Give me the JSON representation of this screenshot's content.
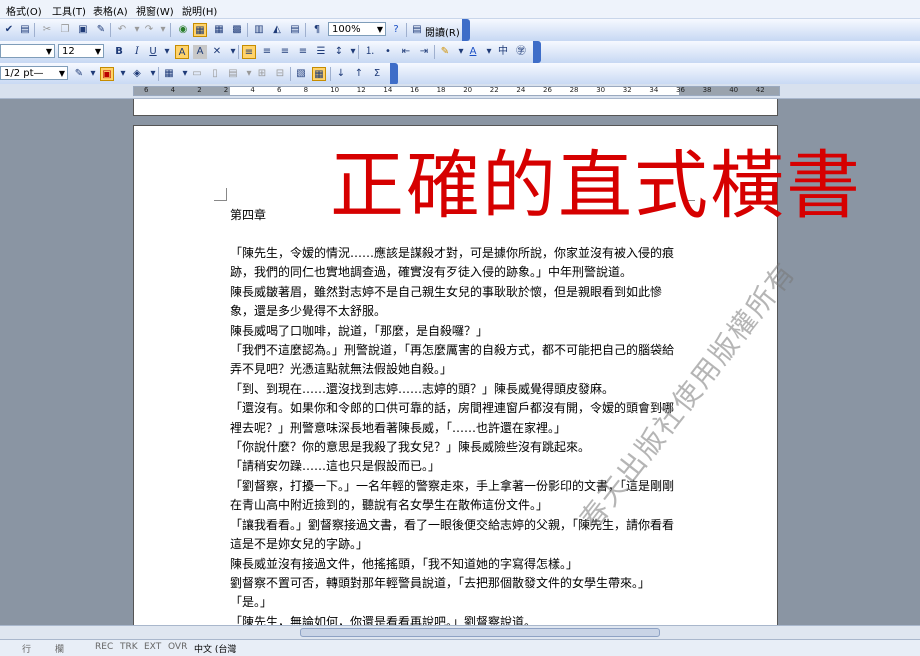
{
  "menu": [
    {
      "label": "格式(O)"
    },
    {
      "label": "工具(T)"
    },
    {
      "label": "表格(A)"
    },
    {
      "label": "視窗(W)"
    },
    {
      "label": "說明(H)"
    }
  ],
  "toolbar1": {
    "zoom": "100%",
    "read_label": "閱讀(R)"
  },
  "toolbar2": {
    "font_size": "12"
  },
  "toolbar3": {
    "border_width": "1/2 pt—"
  },
  "ruler": {
    "numbers": [
      "6",
      "4",
      "2",
      "2",
      "4",
      "6",
      "8",
      "10",
      "12",
      "14",
      "16",
      "18",
      "20",
      "22",
      "24",
      "26",
      "28",
      "30",
      "32",
      "34",
      "36",
      "38",
      "40",
      "42"
    ]
  },
  "overlay": {
    "title": "正確的直式橫書",
    "watermark": "春天出版社使用版權所有"
  },
  "document": {
    "chapter": "第四章",
    "paragraphs": [
      "「陳先生，令嫒的情況……應該是謀殺才對，可是據你所說，你家並沒有被入侵的痕跡，我們的同仁也實地調查過，確實沒有歹徒入侵的跡象。」中年刑警說道。",
      "陳長威皺著眉，雖然對志婷不是自己親生女兒的事耿耿於懷，但是親眼看到如此慘象，還是多少覺得不太舒服。",
      "陳長威喝了口咖啡，說道，「那麼，是自殺囉？」",
      "「我們不這麼認為。」刑警說道，「再怎麼厲害的自殺方式，都不可能把自己的腦袋給弄不見吧？光憑這點就無法假設她自殺。」",
      "「到、到現在……還沒找到志婷……志婷的頭？」陳長威覺得頭皮發麻。",
      "「還沒有。如果你和令郎的口供可靠的話，房間裡連窗戶都沒有開，令嫒的頭會到哪裡去呢？」刑警意味深長地看著陳長威，「……也許還在家裡。」",
      "「你說什麼？你的意思是我殺了我女兒？」陳長威險些沒有跳起來。",
      "「請稍安勿躁……這也只是假設而已。」",
      "「劉督察，打擾一下。」一名年輕的警察走來，手上拿著一份影印的文書，「這是剛剛在青山高中附近撿到的，聽說有名女學生在散佈這份文件。」",
      "「讓我看看。」劉督察接過文書，看了一眼後便交給志婷的父親，「陳先生，請你看看這是不是妳女兒的字跡。」",
      "陳長威並沒有接過文件，他搖搖頭，「我不知道她的字寫得怎樣。」",
      "劉督察不置可否，轉頭對那年輕警員說道，「去把那個散發文件的女學生帶來。」",
      "「是。」",
      "「陳先生，無論如何，你還是看看再說吧。」劉督察說道。"
    ]
  },
  "status": {
    "items": [
      "行",
      "欄",
      "REC",
      "TRK",
      "EXT",
      "OVR",
      "中文 (台灣"
    ]
  }
}
